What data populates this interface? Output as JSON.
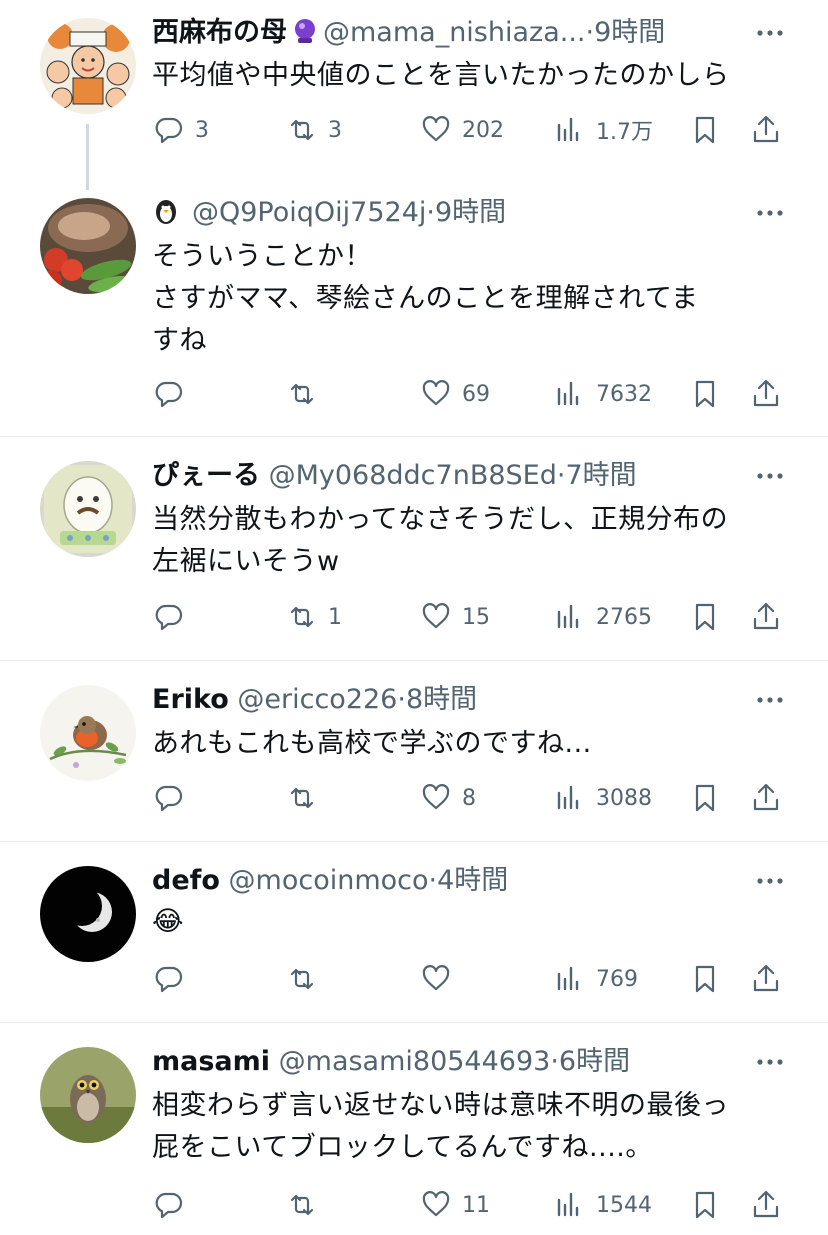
{
  "posts": [
    {
      "name": "西麻布の母",
      "handle": "@mama_nishiaza...",
      "sep": "·",
      "time": "9時間",
      "text": "平均値や中央値のことを言いたかったのかしら",
      "replies": "3",
      "reposts": "3",
      "likes": "202",
      "views": "1.7万"
    },
    {
      "name": "",
      "handle": "@Q9PoiqOij7524j",
      "sep": "·",
      "time": "9時間",
      "text": "そういうことか！\nさすがママ、琴絵さんのことを理解されてま\nすね",
      "replies": "",
      "reposts": "",
      "likes": "69",
      "views": "7632"
    },
    {
      "name": "ぴぇーる",
      "handle": "@My068ddc7nB8SEd",
      "sep": "·",
      "time": "7時間",
      "text": "当然分散もわかってなさそうだし、正規分布の\n左裾にいそうw",
      "replies": "",
      "reposts": "1",
      "likes": "15",
      "views": "2765"
    },
    {
      "name": "Eriko",
      "handle": "@ericco226",
      "sep": "·",
      "time": "8時間",
      "text": "あれもこれも高校で学ぶのですね...",
      "replies": "",
      "reposts": "",
      "likes": "8",
      "views": "3088"
    },
    {
      "name": "defo",
      "handle": "@mocoinmoco",
      "sep": "·",
      "time": "4時間",
      "text": "😂",
      "replies": "",
      "reposts": "",
      "likes": "",
      "views": "769"
    },
    {
      "name": "masami",
      "handle": "@masami80544693",
      "sep": "·",
      "time": "6時間",
      "text": "相変わらず言い返せない時は意味不明の最後っ\n屁をこいてブロックしてるんですね....。",
      "replies": "",
      "reposts": "",
      "likes": "11",
      "views": "1544"
    }
  ],
  "icons": {
    "reply": "speech-bubble-icon",
    "repost": "repost-arrows-icon",
    "like": "heart-icon",
    "views": "bar-chart-icon",
    "bookmark": "bookmark-icon",
    "share": "share-upload-icon",
    "more": "more-dots-icon",
    "badge": "crystal-ball-badge-icon",
    "handle_badge": "penguin-icon"
  },
  "colors": {
    "text": "#0f1419",
    "secondary": "#536471",
    "divider": "#e7e9ea"
  }
}
